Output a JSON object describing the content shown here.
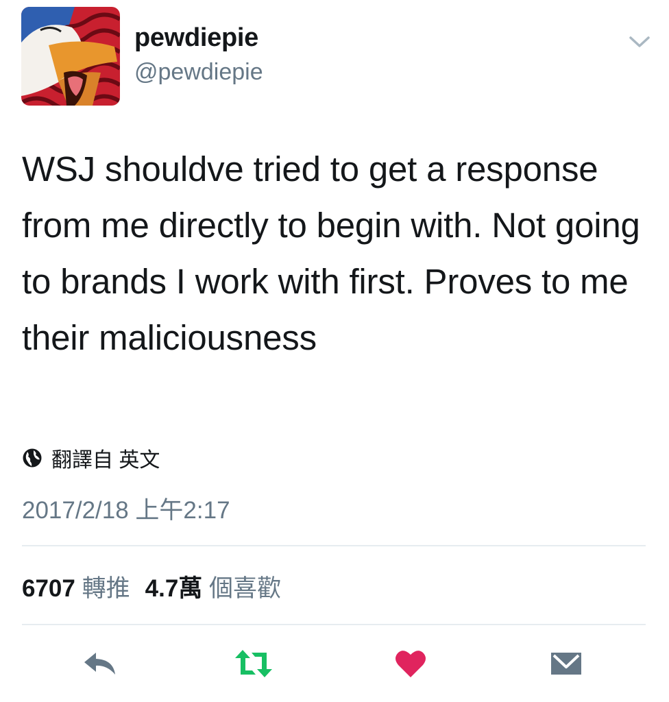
{
  "user": {
    "display_name": "pewdiepie",
    "handle": "@pewdiepie"
  },
  "tweet": {
    "text": "WSJ shouldve tried to get a response from me directly to begin with. Not going to brands I work with first. Proves to me their maliciousness",
    "translate_label": "翻譯自 英文",
    "timestamp": "2017/2/18 上午2:17"
  },
  "stats": {
    "retweets_count": "6707",
    "retweets_label": "轉推",
    "likes_count": "4.7萬",
    "likes_label": "個喜歡"
  },
  "actions": {
    "reply_icon": "reply-icon",
    "retweet_icon": "retweet-icon",
    "like_icon": "heart-icon",
    "dm_icon": "envelope-icon"
  },
  "colors": {
    "text_primary": "#14171a",
    "text_secondary": "#657786",
    "retweet_green": "#17bf63",
    "like_red": "#e0245e",
    "divider": "#e6ecf0"
  }
}
